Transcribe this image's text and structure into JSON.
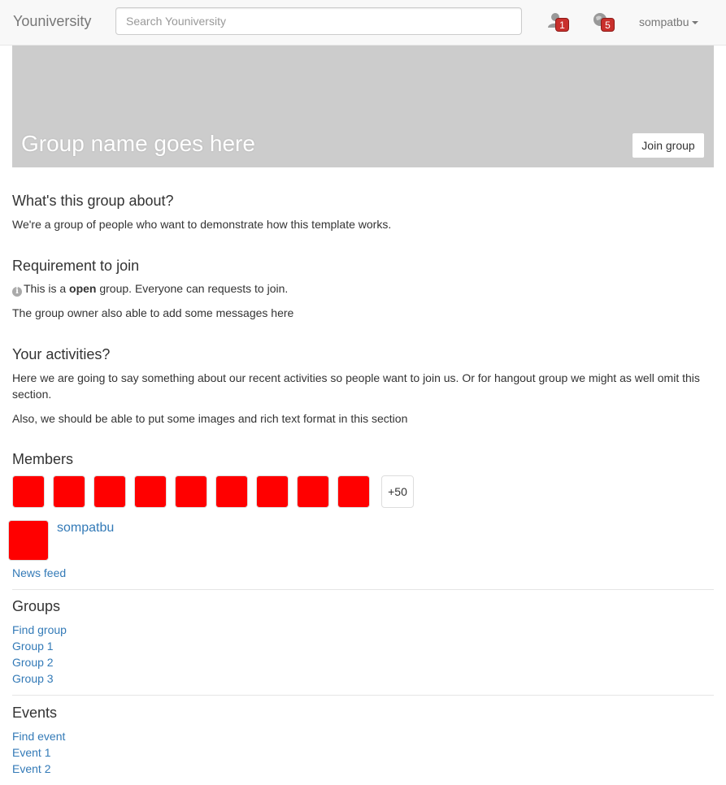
{
  "navbar": {
    "brand": "Youniversity",
    "search_placeholder": "Search Youniversity",
    "friend_requests_count": "1",
    "notifications_count": "5",
    "username": "sompatbu"
  },
  "banner": {
    "group_name": "Group name goes here",
    "join_label": "Join group"
  },
  "about": {
    "heading": "What's this group about?",
    "text": "We're a group of people who want to demonstrate how this template works."
  },
  "requirement": {
    "heading": "Requirement to join",
    "note_prefix": "This is a ",
    "note_bold": "open",
    "note_suffix": " group. Everyone can requests to join.",
    "message": "The group owner also able to add some messages here"
  },
  "activities": {
    "heading": "Your activities?",
    "text1": "Here we are going to say something about our recent activities so people want to join us. Or for hangout group we might as well omit this section.",
    "text2": "Also, we should be able to put some images and rich text format in this section"
  },
  "members": {
    "heading": "Members",
    "thumb_color": "#ff0000",
    "more_label": "+50"
  },
  "sidebar": {
    "profile_name": "sompatbu",
    "news_feed": "News feed",
    "groups_heading": "Groups",
    "groups": [
      "Find group",
      "Group 1",
      "Group 2",
      "Group 3"
    ],
    "events_heading": "Events",
    "events": [
      "Find event",
      "Event 1",
      "Event 2"
    ]
  },
  "colors": {
    "link": "#337ab7",
    "badge": "#c9302c",
    "banner": "#cccccc"
  }
}
